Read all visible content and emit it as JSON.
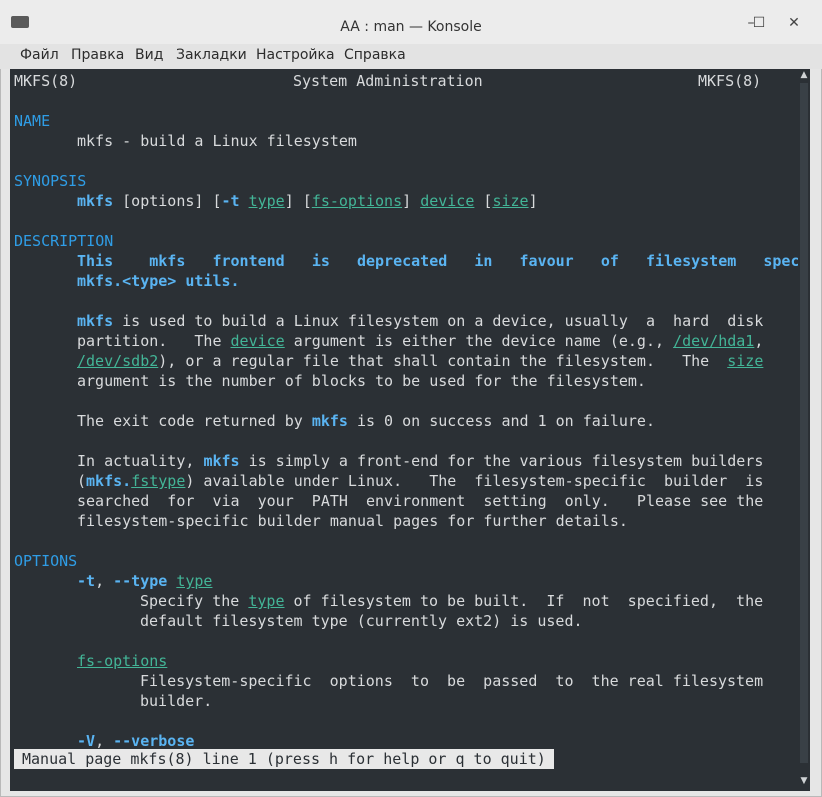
{
  "window": {
    "title": "AA : man — Konsole",
    "controls": [
      "–",
      "☐",
      "✕"
    ]
  },
  "menu": [
    "Файл",
    "Правка",
    "Вид",
    "Закладки",
    "Настройка",
    "Справка"
  ],
  "header": {
    "left": "MKFS(8)",
    "center": "System Administration",
    "right": "MKFS(8)"
  },
  "name": {
    "heading": "NAME",
    "text": "mkfs - build a Linux filesystem"
  },
  "synopsis": {
    "heading": "SYNOPSIS",
    "parts": [
      "mkfs",
      " [options] [",
      "-t",
      " ",
      "type",
      "] [",
      "fs-options",
      "] ",
      "device",
      " [",
      "size",
      "]"
    ]
  },
  "description": {
    "heading": "DESCRIPTION",
    "deprecated": [
      "This",
      "mkfs",
      "frontend",
      "is",
      "deprecated",
      "in",
      "favour",
      "of",
      "filesystem",
      "specific"
    ],
    "deprecated_tail": "mkfs.<type> utils.",
    "p1": {
      "l1": [
        "mkfs",
        " is used to build a Linux filesystem on a device, usually  a  hard  disk"
      ],
      "l2": [
        "partition.   The ",
        "device",
        " argument is either the device name (e.g., ",
        "/dev/hda1",
        ","
      ],
      "l3": [
        "/dev/sdb2",
        "), or a regular file that shall contain the filesystem.   The  ",
        "size"
      ],
      "l4": "argument is the number of blocks to be used for the filesystem."
    },
    "p2": [
      "The exit code returned by ",
      "mkfs",
      " is 0 on success and 1 on failure."
    ],
    "p3": {
      "l1": [
        "In actuality, ",
        "mkfs",
        " is simply a front-end for the various filesystem builders"
      ],
      "l2": [
        "(",
        "mkfs",
        ".",
        "fstype",
        ") available under Linux.   The  filesystem-specific  builder  is"
      ],
      "l3": "searched  for  via  your  PATH  environment  setting  only.   Please see the",
      "l4": "filesystem-specific builder manual pages for further details."
    }
  },
  "options": {
    "heading": "OPTIONS",
    "type_opt": [
      "-t",
      ", ",
      "--type",
      " ",
      "type"
    ],
    "type_desc1": [
      "Specify the ",
      "type",
      " of filesystem to be built.  If  not  specified,  the"
    ],
    "type_desc2": "default filesystem type (currently ext2) is used.",
    "fs_opt": "fs-options",
    "fs_desc1": "Filesystem-specific  options  to  be  passed  to  the real filesystem",
    "fs_desc2": "builder.",
    "verbose_opt": [
      "-V",
      ", ",
      "--verbose"
    ]
  },
  "status": "Manual page mkfs(8) line 1 (press h for help or q to quit)",
  "colors": {
    "background": "#2b3035",
    "text": "#d8dadc",
    "bold": "#5ab4f2",
    "link": "#43b597",
    "section": "#2f9de6"
  }
}
